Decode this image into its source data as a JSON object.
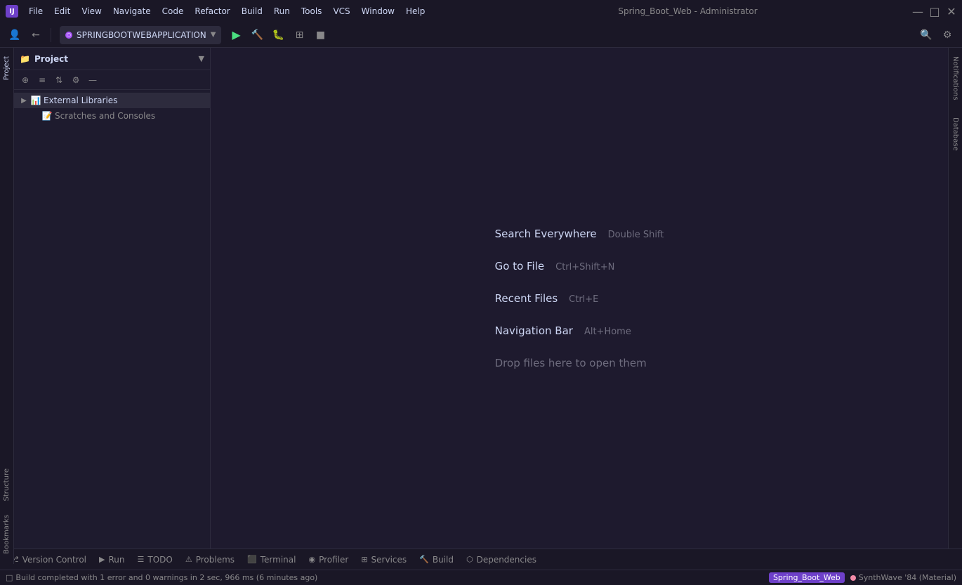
{
  "titlebar": {
    "logo": "IJ",
    "menu_items": [
      "File",
      "Edit",
      "View",
      "Navigate",
      "Code",
      "Refactor",
      "Build",
      "Run",
      "Tools",
      "VCS",
      "Window",
      "Help"
    ],
    "title": "Spring_Boot_Web - Administrator",
    "win_min": "—",
    "win_max": "□",
    "win_close": "✕"
  },
  "toolbar": {
    "run_config_name": "SPRINGBOOTWEBAPPLICATION",
    "buttons": [
      "⊕",
      "≡",
      "⇅",
      "⚙",
      "—"
    ]
  },
  "project_panel": {
    "title": "Project",
    "items": [
      {
        "label": "External Libraries",
        "type": "folder",
        "icon": "📊",
        "indent": 0,
        "expanded": true
      },
      {
        "label": "Scratches and Consoles",
        "type": "folder",
        "icon": "📝",
        "indent": 1,
        "expanded": false
      }
    ]
  },
  "welcome": {
    "search_everywhere_label": "Search Everywhere",
    "search_everywhere_shortcut": "Double Shift",
    "go_to_file_label": "Go to File",
    "go_to_file_shortcut": "Ctrl+Shift+N",
    "recent_files_label": "Recent Files",
    "recent_files_shortcut": "Ctrl+E",
    "navigation_bar_label": "Navigation Bar",
    "navigation_bar_shortcut": "Alt+Home",
    "drop_files_label": "Drop files here to open them"
  },
  "bottom_tabs": [
    {
      "label": "Version Control",
      "icon": "⎇"
    },
    {
      "label": "Run",
      "icon": "▶"
    },
    {
      "label": "TODO",
      "icon": "☰"
    },
    {
      "label": "Problems",
      "icon": "⚠"
    },
    {
      "label": "Terminal",
      "icon": "⬛"
    },
    {
      "label": "Profiler",
      "icon": "◉"
    },
    {
      "label": "Services",
      "icon": "⊞"
    },
    {
      "label": "Build",
      "icon": "🔨"
    },
    {
      "label": "Dependencies",
      "icon": "⬡"
    }
  ],
  "status_bar": {
    "message": "Build completed with 1 error and 0 warnings in 2 sec, 966 ms (6 minutes ago)",
    "project_label": "Spring_Boot_Web",
    "theme_label": "SynthWave '84 (Material)"
  },
  "right_strip": {
    "notifications_label": "Notifications",
    "database_label": "Database"
  },
  "left_strip": {
    "project_label": "Project"
  },
  "left_vertical": {
    "structure_label": "Structure",
    "bookmarks_label": "Bookmarks"
  }
}
